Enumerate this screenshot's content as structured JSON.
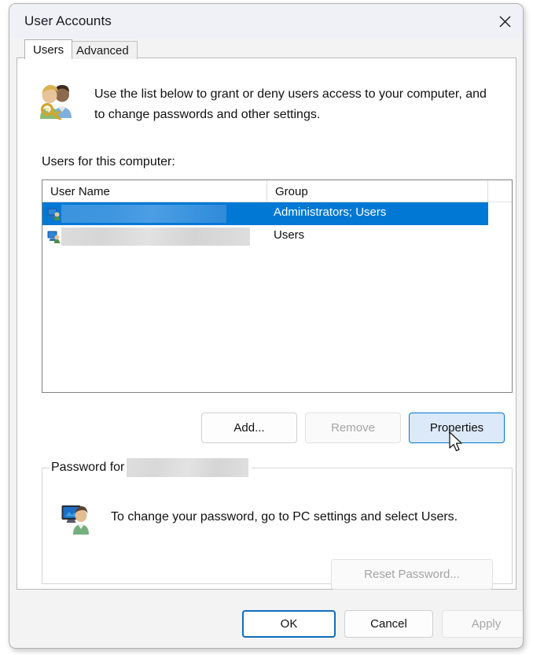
{
  "window": {
    "title": "User Accounts",
    "close_icon": "close-icon"
  },
  "tabs": [
    {
      "label": "Users",
      "selected": true
    },
    {
      "label": "Advanced",
      "selected": false
    }
  ],
  "intro": {
    "icon": "users-key-icon",
    "text": "Use the list below to grant or deny users access to your computer, and to change passwords and other settings."
  },
  "users_list": {
    "label": "Users for this computer:",
    "columns": [
      "User Name",
      "Group",
      ""
    ],
    "rows": [
      {
        "user_name": "",
        "user_name_redacted": true,
        "group": "Administrators; Users",
        "selected": true,
        "icon": "user-computer-icon"
      },
      {
        "user_name": "",
        "user_name_redacted": true,
        "group": "Users",
        "selected": false,
        "icon": "user-computer-icon"
      }
    ]
  },
  "actions": {
    "add_label": "Add...",
    "remove_label": "Remove",
    "properties_label": "Properties"
  },
  "password_group": {
    "legend": "Password for",
    "legend_value_redacted": true,
    "icon": "user-account-icon",
    "text": "To change your password, go to PC settings and select Users.",
    "reset_label": "Reset Password..."
  },
  "footer": {
    "ok_label": "OK",
    "cancel_label": "Cancel",
    "apply_label": "Apply"
  },
  "colors": {
    "accent": "#0078d4",
    "selection": "#0078d4",
    "default_border": "#0f6cbd",
    "titlebar": "#f0f0f7",
    "dialog_bg": "#f3f3f3"
  }
}
